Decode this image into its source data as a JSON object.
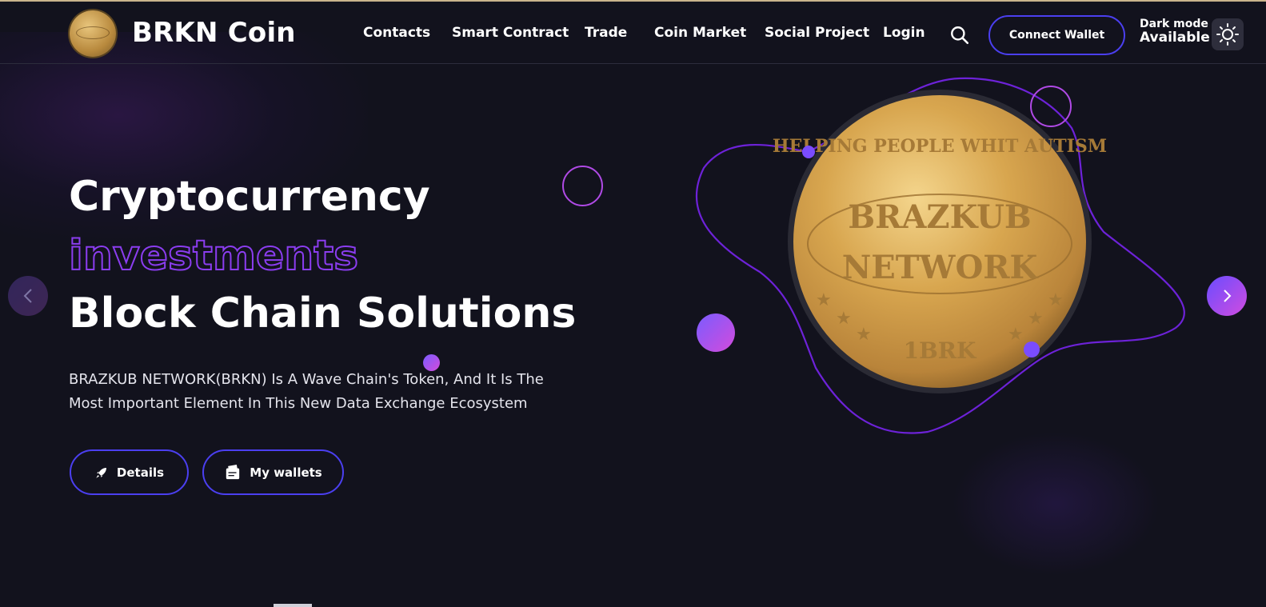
{
  "header": {
    "brand": "BRKN Coin",
    "nav": [
      "Contacts",
      "Smart Contract",
      "Trade",
      "Coin Market",
      "Social Project",
      "Login"
    ],
    "connect_wallet": "Connect Wallet",
    "dark_mode_line1": "Dark mode",
    "dark_mode_line2": "Available"
  },
  "hero": {
    "title_line1": "Cryptocurrency",
    "title_line2": "investments",
    "title_line3": "Block Chain Solutions",
    "description": "BRAZKUB NETWORK(BRKN) Is A Wave Chain's Token, And It Is The Most Important Element In This New Data Exchange Ecosystem",
    "btn_details": "Details",
    "btn_wallets": "My wallets"
  },
  "coin": {
    "top_text": "HELPING PEOPLE WHIT AUTISM",
    "center_line1": "BRAZKUB",
    "center_line2": "NETWORK",
    "bottom_text": "1BRK"
  },
  "colors": {
    "background": "#12121d",
    "accent_blue": "#4b3ff0",
    "accent_purple": "#8b3df0",
    "gradient_end": "#d14ce0",
    "gold": "#d4a958"
  },
  "icons": {
    "search": "search-icon",
    "theme": "sun-icon",
    "details": "rocket-icon",
    "wallets": "wallet-icon",
    "prev": "chevron-left-icon",
    "next": "chevron-right-icon"
  }
}
